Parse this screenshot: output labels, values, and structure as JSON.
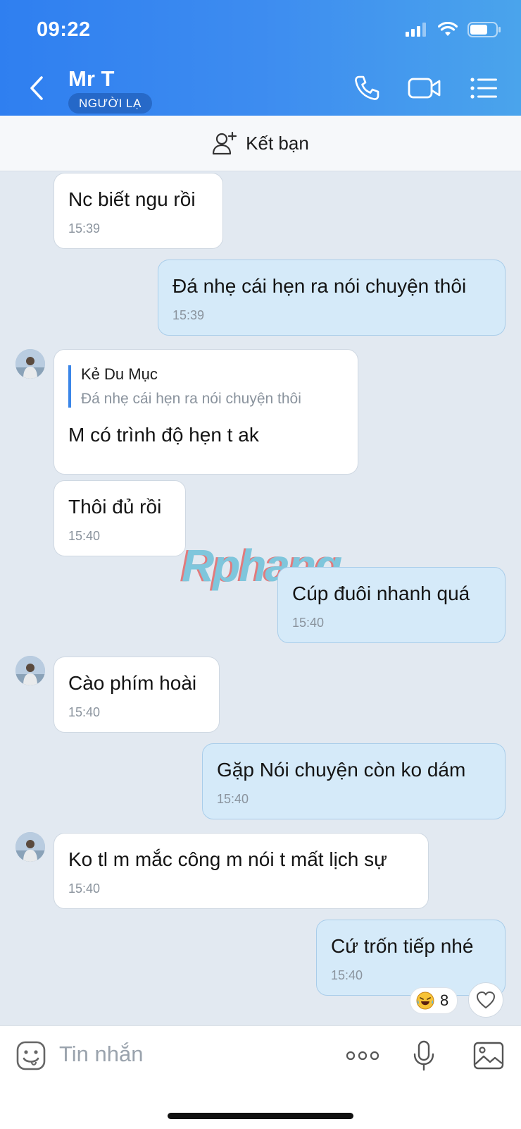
{
  "status_bar": {
    "time": "09:22"
  },
  "header": {
    "contact_name": "Mr T",
    "badge": "NGƯỜI LẠ"
  },
  "friend_bar": {
    "label": "Kết bạn"
  },
  "messages": [
    {
      "text": "Nc biết ngu rồi",
      "time": "15:39",
      "direction": "received"
    },
    {
      "text": "Đá nhẹ cái hẹn ra nói chuyện thôi",
      "time": "15:39",
      "direction": "sent"
    },
    {
      "text": "M có trình độ hẹn t ak",
      "direction": "received",
      "quote": {
        "author": "Kẻ Du Mục",
        "text": "Đá nhẹ cái hẹn ra nói chuyện thôi"
      }
    },
    {
      "text": "Thôi đủ rồi",
      "time": "15:40",
      "direction": "received"
    },
    {
      "text": "Cúp đuôi nhanh quá",
      "time": "15:40",
      "direction": "sent"
    },
    {
      "text": "Cào phím hoài",
      "time": "15:40",
      "direction": "received"
    },
    {
      "text": "Gặp Nói chuyện còn ko dám",
      "time": "15:40",
      "direction": "sent"
    },
    {
      "text": "Ko tl m mắc công m nói t mất lịch sự",
      "time": "15:40",
      "direction": "received"
    },
    {
      "text": "Cứ trốn tiếp nhé",
      "time": "15:40",
      "direction": "sent"
    }
  ],
  "reaction": {
    "icon": "laughing-crying-emoji",
    "count": "8"
  },
  "watermark": "Rphang",
  "input": {
    "placeholder": "Tin nhắn"
  },
  "colors": {
    "header_start": "#2f7ff0",
    "header_end": "#4aa4ec",
    "chat_background": "#e2e9f1",
    "sent_bubble": "#d5eaf9",
    "received_bubble": "#ffffff",
    "quote_bar": "#3b86e8"
  }
}
